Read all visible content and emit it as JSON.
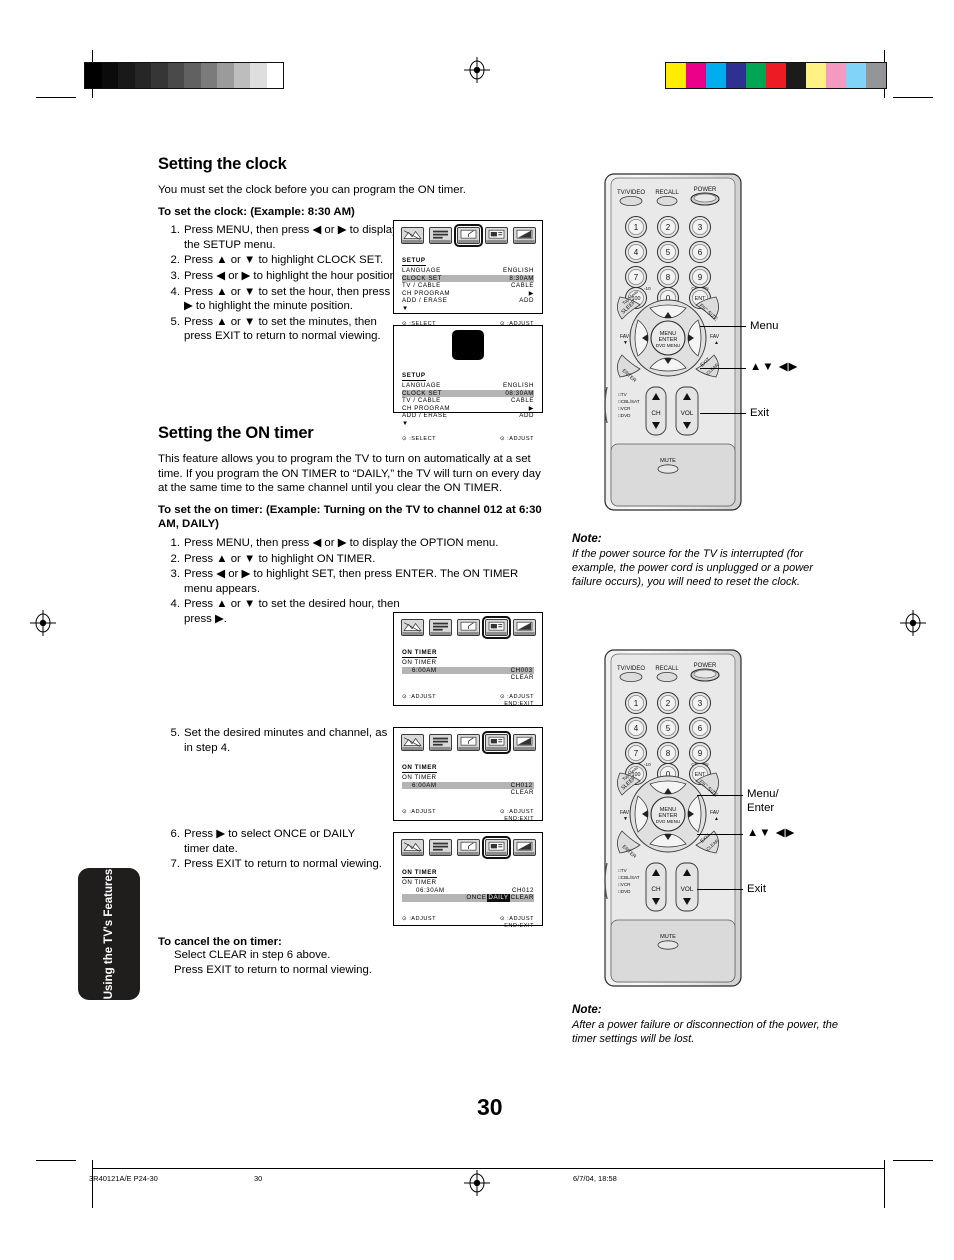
{
  "page": {
    "number": "30",
    "side_tab": "Using the TV's Features"
  },
  "section_clock": {
    "heading": "Setting the clock",
    "intro": "You must set the clock before you can program the ON timer.",
    "lead": "To set the clock: (Example: 8:30 AM)",
    "steps": [
      "Press MENU, then press ◀ or ▶ to display the SETUP menu.",
      "Press ▲ or ▼ to highlight CLOCK SET.",
      "Press ◀ or ▶ to highlight the hour position.",
      "Press ▲ or ▼ to set the hour, then press ▶ to highlight the minute position.",
      "Press ▲ or ▼ to set the minutes, then press EXIT to return to normal viewing."
    ]
  },
  "section_ontimer": {
    "heading": "Setting the ON timer",
    "intro": "This feature allows you to program the TV to turn on automatically at a set time. If you program the ON TIMER to “DAILY,” the TV will turn on every day at the same time to the same channel until you clear the ON TIMER.",
    "lead": "To set the on timer: (Example: Turning on the TV to channel 012 at 6:30 AM, DAILY)",
    "steps_1_4": [
      "Press MENU, then press ◀ or ▶ to display the OPTION menu.",
      "Press ▲ or ▼ to highlight ON TIMER.",
      "Press ◀ or ▶ to highlight SET, then press ENTER. The ON TIMER menu appears.",
      "Press ▲ or ▼ to set the desired hour, then press ▶."
    ],
    "step_5": "Set the desired minutes and channel, as in step 4.",
    "steps_6_7": [
      "Press ▶ to select ONCE or DAILY timer date.",
      "Press EXIT to return to normal viewing."
    ],
    "cancel_heading": "To cancel the on timer:",
    "cancel_lines": [
      "Select CLEAR in step 6 above.",
      "Press EXIT to return to normal viewing."
    ]
  },
  "osd_setup_1": {
    "selected_icon_index": 2,
    "menu_title": "SETUP",
    "rows": [
      {
        "label": "LANGUAGE",
        "value": "ENGLISH",
        "highlight": false
      },
      {
        "label": "CLOCK SET",
        "value": "8:30AM",
        "highlight": true
      },
      {
        "label": "TV / CABLE",
        "value": "CABLE",
        "highlight": false
      },
      {
        "label": "CH PROGRAM",
        "value": "▶",
        "highlight": false
      },
      {
        "label": "ADD / ERASE",
        "value": "ADD",
        "highlight": false
      },
      {
        "label": "▼",
        "value": "",
        "highlight": false
      }
    ],
    "foot_left": "⊙ :SELECT",
    "foot_right": "⊙ :ADJUST"
  },
  "osd_setup_2": {
    "selected_icon_index": 2,
    "menu_title": "SETUP",
    "rows": [
      {
        "label": "LANGUAGE",
        "value": "ENGLISH",
        "highlight": false
      },
      {
        "label": "CLOCK SET",
        "value": "08:30AM",
        "highlight": true
      },
      {
        "label": "TV / CABLE",
        "value": "CABLE",
        "highlight": false
      },
      {
        "label": "CH PROGRAM",
        "value": "▶",
        "highlight": false
      },
      {
        "label": "ADD / ERASE",
        "value": "ADD",
        "highlight": false
      },
      {
        "label": "▼",
        "value": "",
        "highlight": false
      }
    ],
    "foot_left": "⊙ :SELECT",
    "foot_right": "⊙ :ADJUST"
  },
  "osd_timer_1": {
    "selected_icon_index": 3,
    "menu_title": "ON TIMER",
    "sub_title": "ON TIMER",
    "time": "6:00AM",
    "channel": "CH003",
    "clear": "CLEAR",
    "foot_left": "⊙ :ADJUST",
    "foot_right_1": "⊙ :ADJUST",
    "foot_right_2": "END:EXIT"
  },
  "osd_timer_2": {
    "selected_icon_index": 3,
    "menu_title": "ON TIMER",
    "sub_title": "ON TIMER",
    "time": "6:00AM",
    "channel": "CH012",
    "clear": "CLEAR",
    "foot_left": "⊙ :ADJUST",
    "foot_right_1": "⊙ :ADJUST",
    "foot_right_2": "END:EXIT"
  },
  "osd_timer_3": {
    "selected_icon_index": 3,
    "menu_title": "ON TIMER",
    "sub_title": "ON TIMER",
    "time": "06:30AM",
    "channel": "CH012",
    "options": [
      "ONCE",
      "DAILY",
      "CLEAR"
    ],
    "selected_option": "DAILY",
    "foot_left": "⊙ :ADJUST",
    "foot_right_1": "⊙ :ADJUST",
    "foot_right_2": "END:EXIT"
  },
  "remote_top": {
    "top_buttons": [
      "TV/VIDEO",
      "RECALL",
      "POWER"
    ],
    "keypad": [
      "1",
      "2",
      "3",
      "4",
      "5",
      "6",
      "7",
      "8",
      "9",
      "100",
      "0",
      "ENT"
    ],
    "keypad_sub_100": "-10",
    "keypad_sub_ent": "CH RTN",
    "center": [
      "MENU",
      "ENTER",
      "DVD MENU"
    ],
    "shoulder_left": "SLEEP",
    "shoulder_left_sub": "Top Menu",
    "shoulder_right": "PIC SIZE",
    "shoulder_left_bottom": "ENTER",
    "shoulder_right_bottom_1": "EXIT",
    "shoulder_right_bottom_2": "CLEAR",
    "fav_down": "FAV▼",
    "fav_up": "FAV▲",
    "ch": "CH",
    "vol": "VOL",
    "mute": "MUTE",
    "mode_list": [
      "TV",
      "CBL/SAT",
      "VCR",
      "DVD"
    ],
    "callouts": [
      "Menu",
      "▲▼ ◀▶",
      "Exit"
    ]
  },
  "remote_bottom": {
    "callouts": [
      "Menu/",
      "Enter",
      "▲▼ ◀▶",
      "Exit"
    ]
  },
  "note_1": {
    "title": "Note:",
    "text": "If the power source for the TV is interrupted (for  example, the power cord is unplugged or a power failure occurs), you will need to reset the clock."
  },
  "note_2": {
    "title": "Note:",
    "text": "After a power failure or disconnection of the power, the timer settings will be lost."
  },
  "footer": {
    "doc_id": "3R40121A/E P24-30",
    "page": "30",
    "datestamp": "6/7/04, 18:58"
  },
  "print_bars": {
    "gray_wedge": [
      "#000000",
      "#0b0b0b",
      "#191919",
      "#262626",
      "#363636",
      "#4a4a4a",
      "#616161",
      "#7b7b7b",
      "#9b9b9b",
      "#bdbdbd",
      "#dedede",
      "#ffffff"
    ],
    "color_bars": [
      "#ffec00",
      "#ec0089",
      "#00adef",
      "#2e3192",
      "#00a651",
      "#ed1c24",
      "#1b1b1b",
      "#fff284",
      "#f49ac1",
      "#81d3f8",
      "#939598"
    ]
  }
}
